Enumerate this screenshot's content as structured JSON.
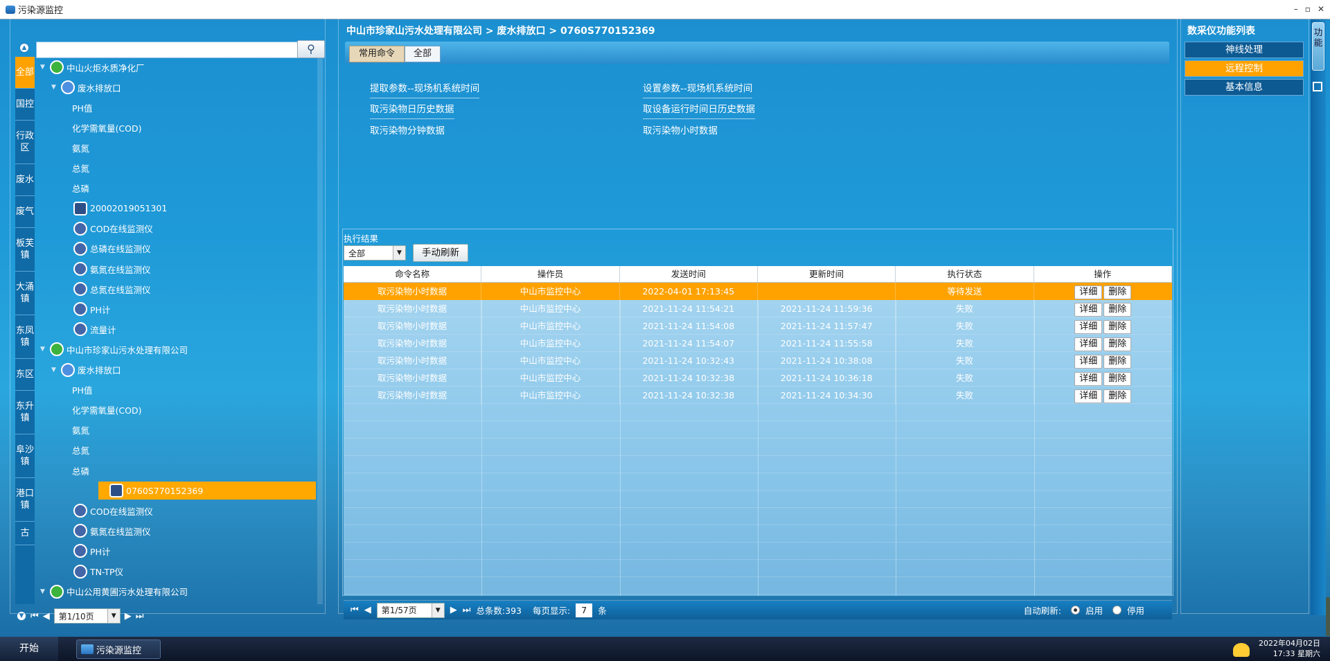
{
  "window": {
    "title": "污染源监控"
  },
  "left": {
    "search_placeholder": "",
    "tabs": [
      "全部",
      "国控",
      "行政区",
      "废水",
      "废气",
      "板芙镇",
      "大涌镇",
      "东凤镇",
      "东区",
      "东升镇",
      "阜沙镇",
      "港口镇",
      "古"
    ],
    "tree": [
      {
        "label": "中山火炬水质净化厂",
        "level": 0,
        "icon": "house-icon",
        "arrow": true
      },
      {
        "label": "废水排放口",
        "level": 1,
        "icon": "drop-icon",
        "arrow": true
      },
      {
        "label": "PH值",
        "level": 2,
        "icon": ""
      },
      {
        "label": "化学需氧量(COD)",
        "level": 2,
        "icon": ""
      },
      {
        "label": "氨氮",
        "level": 2,
        "icon": ""
      },
      {
        "label": "总氮",
        "level": 2,
        "icon": ""
      },
      {
        "label": "总磷",
        "level": 2,
        "icon": ""
      },
      {
        "label": "20002019051301",
        "level": 2,
        "icon": "pc-icon"
      },
      {
        "label": "COD在线监测仪",
        "level": 2,
        "icon": "device-icon"
      },
      {
        "label": "总磷在线监测仪",
        "level": 2,
        "icon": "device-icon"
      },
      {
        "label": "氨氮在线监测仪",
        "level": 2,
        "icon": "device-icon"
      },
      {
        "label": "总氮在线监测仪",
        "level": 2,
        "icon": "device-icon"
      },
      {
        "label": "PH计",
        "level": 2,
        "icon": "device-icon"
      },
      {
        "label": "流量计",
        "level": 2,
        "icon": "device-icon"
      },
      {
        "label": "中山市珍家山污水处理有限公司",
        "level": 0,
        "icon": "house-icon",
        "arrow": true
      },
      {
        "label": "废水排放口",
        "level": 1,
        "icon": "drop-icon",
        "arrow": true
      },
      {
        "label": "PH值",
        "level": 2,
        "icon": ""
      },
      {
        "label": "化学需氧量(COD)",
        "level": 2,
        "icon": ""
      },
      {
        "label": "氨氮",
        "level": 2,
        "icon": ""
      },
      {
        "label": "总氮",
        "level": 2,
        "icon": ""
      },
      {
        "label": "总磷",
        "level": 2,
        "icon": ""
      },
      {
        "label": "0760S770152369",
        "level": 2,
        "icon": "pc-icon",
        "selected": true
      },
      {
        "label": "COD在线监测仪",
        "level": 2,
        "icon": "device-icon"
      },
      {
        "label": "氨氮在线监测仪",
        "level": 2,
        "icon": "device-icon"
      },
      {
        "label": "PH计",
        "level": 2,
        "icon": "device-icon"
      },
      {
        "label": "TN-TP仪",
        "level": 2,
        "icon": "device-icon"
      },
      {
        "label": "中山公用黄圃污水处理有限公司",
        "level": 0,
        "icon": "house-icon",
        "arrow": true
      }
    ],
    "pager": {
      "page_label": "第1/10页"
    }
  },
  "center": {
    "breadcrumb": "中山市珍家山污水处理有限公司 > 废水排放口 > 0760S770152369",
    "cmd_tabs": [
      "常用命令",
      "全部"
    ],
    "commands_left": [
      "提取参数--现场机系统时间",
      "取污染物日历史数据",
      "取污染物分钟数据"
    ],
    "commands_right": [
      "设置参数--现场机系统时间",
      "取设备运行时间日历史数据",
      "取污染物小时数据"
    ],
    "result_label": "执行结果",
    "filter_value": "全部",
    "refresh_label": "手动刷新",
    "columns": [
      "命令名称",
      "操作员",
      "发送时间",
      "更新时间",
      "执行状态",
      "操作"
    ],
    "rows": [
      {
        "name": "取污染物小时数据",
        "operator": "中山市监控中心",
        "sent": "2022-04-01 17:13:45",
        "updated": "",
        "status": "等待发送",
        "highlight": true
      },
      {
        "name": "取污染物小时数据",
        "operator": "中山市监控中心",
        "sent": "2021-11-24 11:54:21",
        "updated": "2021-11-24 11:59:36",
        "status": "失败"
      },
      {
        "name": "取污染物小时数据",
        "operator": "中山市监控中心",
        "sent": "2021-11-24 11:54:08",
        "updated": "2021-11-24 11:57:47",
        "status": "失败"
      },
      {
        "name": "取污染物小时数据",
        "operator": "中山市监控中心",
        "sent": "2021-11-24 11:54:07",
        "updated": "2021-11-24 11:55:58",
        "status": "失败"
      },
      {
        "name": "取污染物小时数据",
        "operator": "中山市监控中心",
        "sent": "2021-11-24 10:32:43",
        "updated": "2021-11-24 10:38:08",
        "status": "失败"
      },
      {
        "name": "取污染物小时数据",
        "operator": "中山市监控中心",
        "sent": "2021-11-24 10:32:38",
        "updated": "2021-11-24 10:36:18",
        "status": "失败"
      },
      {
        "name": "取污染物小时数据",
        "operator": "中山市监控中心",
        "sent": "2021-11-24 10:32:38",
        "updated": "2021-11-24 10:34:30",
        "status": "失败"
      }
    ],
    "detail_label": "详细",
    "delete_label": "删除",
    "pager": {
      "page_label": "第1/57页",
      "total": "总条数:393",
      "per_page_label": "每页显示:",
      "per_page": "7",
      "unit": "条",
      "auto_refresh": "自动刷新:",
      "on": "启用",
      "off": "停用"
    }
  },
  "right": {
    "title": "数采仪功能列表",
    "items": [
      "神线处理",
      "远程控制",
      "基本信息"
    ],
    "side_tab": "功能"
  },
  "taskbar": {
    "start": "开始",
    "app": "污染源监控",
    "date": "2022年04月02日",
    "time": "17:33  星期六"
  }
}
